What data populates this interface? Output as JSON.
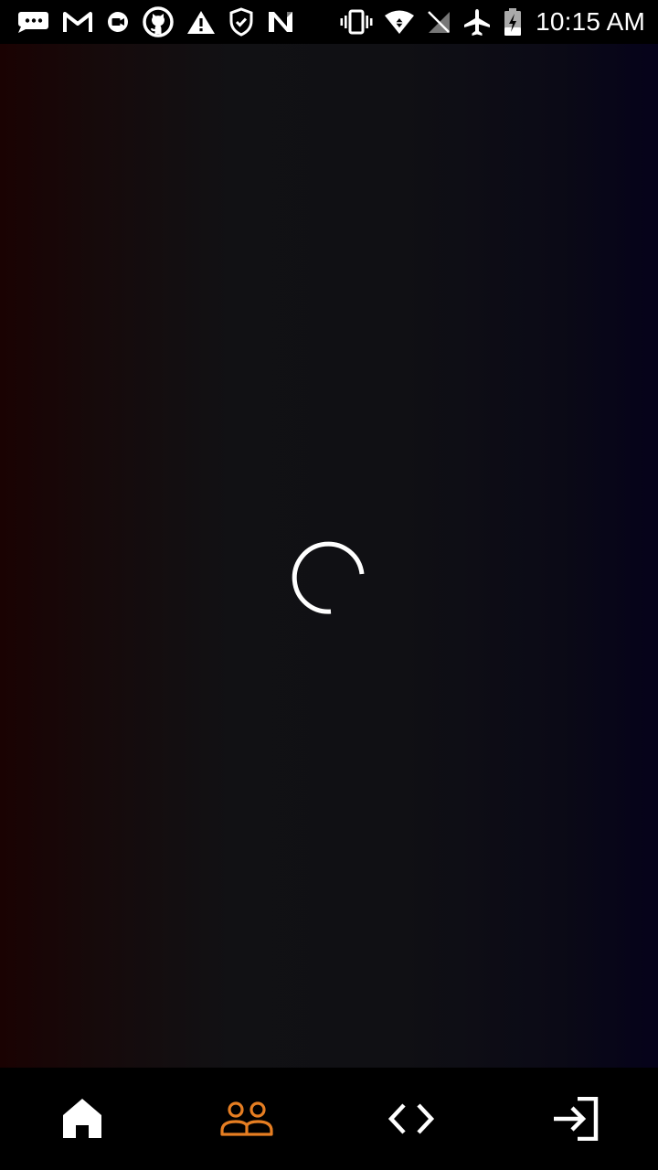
{
  "status_bar": {
    "time": "10:15 AM",
    "left_icons": [
      "messages-icon",
      "gmail-icon",
      "meet-icon",
      "github-icon",
      "warning-icon",
      "shield-check-icon",
      "n-app-icon"
    ],
    "right_icons": [
      "vibrate-icon",
      "wifi-icon",
      "no-sim-icon",
      "airplane-mode-icon",
      "battery-charging-icon"
    ]
  },
  "loading": {
    "spinner_icon": "loading-spinner-icon"
  },
  "bottom_nav": {
    "items": [
      {
        "icon": "home-icon",
        "active": false
      },
      {
        "icon": "people-icon",
        "active": true
      },
      {
        "icon": "code-icon",
        "active": false
      },
      {
        "icon": "login-icon",
        "active": false
      }
    ],
    "active_color": "#e67e22",
    "inactive_color": "#ffffff"
  },
  "colors": {
    "background_left": "#1a0202",
    "background_mid": "#101014",
    "background_right": "#05021a",
    "nav_background": "#000000"
  }
}
